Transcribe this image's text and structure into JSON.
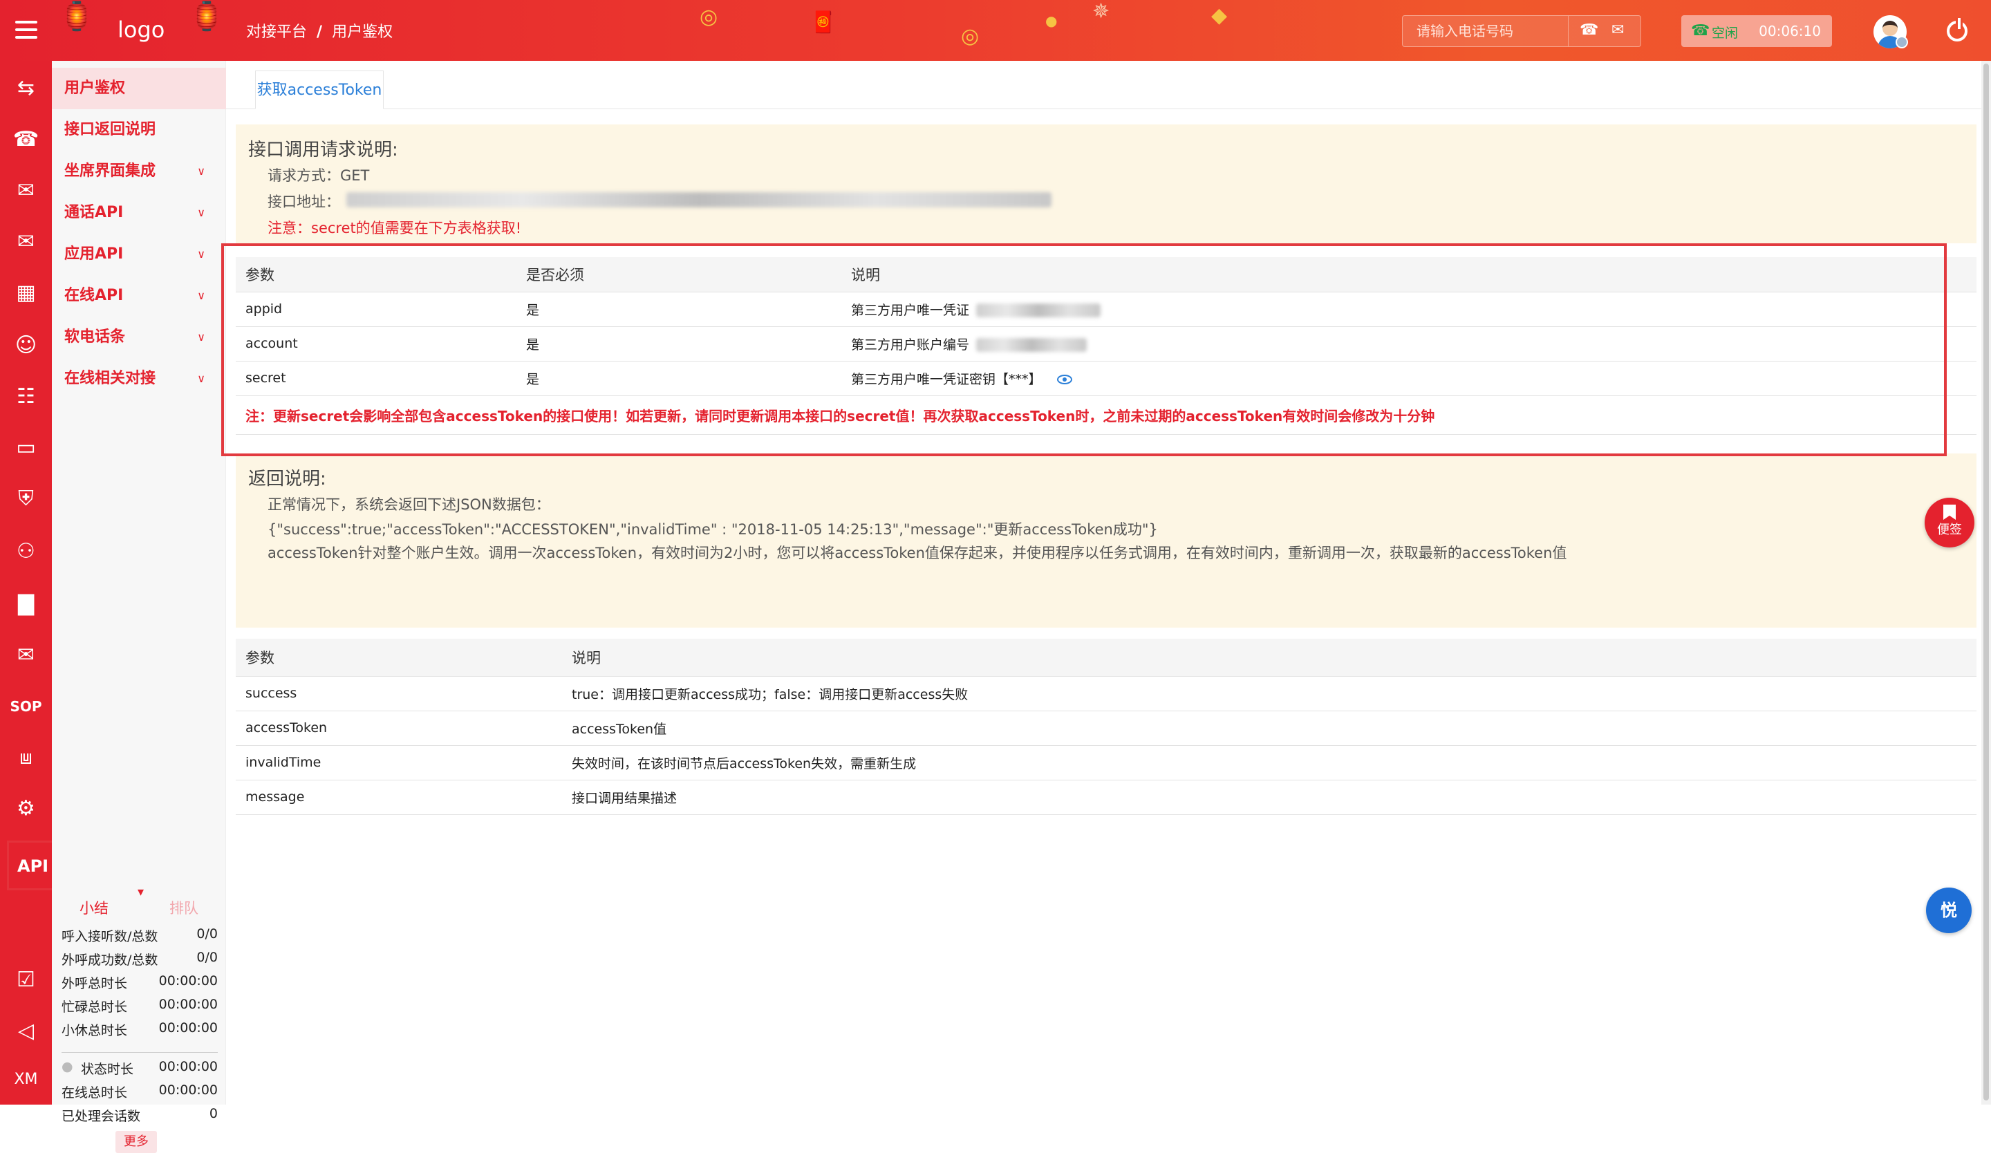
{
  "header": {
    "logo": "logo",
    "breadcrumb": [
      "对接平台",
      "用户鉴权"
    ],
    "breadcrumb_sep": "/",
    "phone_placeholder": "请输入电话号码",
    "status_label": "空闲",
    "status_time": "00:06:10"
  },
  "menu": {
    "items": [
      {
        "label": "用户鉴权",
        "active": true,
        "expandable": false
      },
      {
        "label": "接口返回说明",
        "active": false,
        "expandable": false
      },
      {
        "label": "坐席界面集成",
        "active": false,
        "expandable": true
      },
      {
        "label": "通话API",
        "active": false,
        "expandable": true
      },
      {
        "label": "应用API",
        "active": false,
        "expandable": true
      },
      {
        "label": "在线API",
        "active": false,
        "expandable": true
      },
      {
        "label": "软电话条",
        "active": false,
        "expandable": true
      },
      {
        "label": "在线相关对接",
        "active": false,
        "expandable": true
      }
    ]
  },
  "rail": {
    "api_label": "API",
    "sop_label": "SOP",
    "xm_label": "XM"
  },
  "stats": {
    "tab_summary": "小结",
    "tab_queue": "排队",
    "rows": [
      {
        "k": "呼入接听数/总数",
        "v": "0/0"
      },
      {
        "k": "外呼成功数/总数",
        "v": "0/0"
      },
      {
        "k": "外呼总时长",
        "v": "00:00:00"
      },
      {
        "k": "忙碌总时长",
        "v": "00:00:00"
      },
      {
        "k": "小休总时长",
        "v": "00:00:00"
      }
    ],
    "rows2": [
      {
        "k": "状态时长",
        "v": "00:00:00"
      },
      {
        "k": "在线总时长",
        "v": "00:00:00"
      },
      {
        "k": "已处理会话数",
        "v": "0"
      }
    ],
    "more": "更多"
  },
  "tab": {
    "label": "获取accessToken"
  },
  "request_note": {
    "title": "接口调用请求说明:",
    "method": "请求方式：GET",
    "address_label": "接口地址：",
    "warning": "注意：secret的值需要在下方表格获取!"
  },
  "params_table": {
    "headers": [
      "参数",
      "是否必须",
      "说明"
    ],
    "rows": [
      {
        "param": "appid",
        "required": "是",
        "desc": "第三方用户唯一凭证"
      },
      {
        "param": "account",
        "required": "是",
        "desc": "第三方用户账户编号"
      },
      {
        "param": "secret",
        "required": "是",
        "desc": "第三方用户唯一凭证密钥【***】"
      }
    ],
    "warning": "注：更新secret会影响全部包含accessToken的接口使用！如若更新，请同时更新调用本接口的secret值！再次获取accessToken时，之前未过期的accessToken有效时间会修改为十分钟"
  },
  "return_note": {
    "title": "返回说明:",
    "line1": "正常情况下，系统会返回下述JSON数据包：",
    "line2": "{\"success\":true;\"accessToken\":\"ACCESSTOKEN\",\"invalidTime\" : \"2018-11-05 14:25:13\",\"message\":\"更新accessToken成功\"}",
    "line3": "accessToken针对整个账户生效。调用一次accessToken，有效时间为2小时，您可以将accessToken值保存起来，并使用程序以任务式调用，在有效时间内，重新调用一次，获取最新的accessToken值"
  },
  "return_table": {
    "headers": [
      "参数",
      "说明"
    ],
    "rows": [
      {
        "param": "success",
        "desc": "true：调用接口更新access成功；false：调用接口更新access失败"
      },
      {
        "param": "accessToken",
        "desc": "accessToken值"
      },
      {
        "param": "invalidTime",
        "desc": "失效时间，在该时间节点后accessToken失效，需重新生成"
      },
      {
        "param": "message",
        "desc": "接口调用结果描述"
      }
    ]
  },
  "floats": {
    "note_label": "便签",
    "chat_label": "悦"
  },
  "colors": {
    "brand_red": "#e4222e",
    "link_blue": "#2b7fd8",
    "note_bg": "#fdf6e4"
  }
}
